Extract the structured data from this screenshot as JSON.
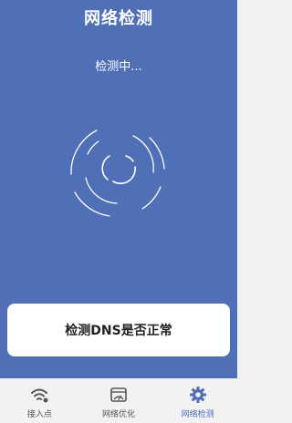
{
  "header": {
    "title": "网络检测"
  },
  "status": {
    "text": "检测中..."
  },
  "result_card": {
    "text": "检测DNS是否正常"
  },
  "tabs": [
    {
      "label": "接入点",
      "icon": "wifi-icon",
      "active": false
    },
    {
      "label": "网络优化",
      "icon": "optimize-icon",
      "active": false
    },
    {
      "label": "网络检测",
      "icon": "settings-gear-icon",
      "active": true
    }
  ],
  "colors": {
    "accent": "#4f6fb7",
    "panel_bg": "#4f6fb7",
    "tabbar_bg": "#f2f2f2",
    "card_bg": "#ffffff"
  }
}
